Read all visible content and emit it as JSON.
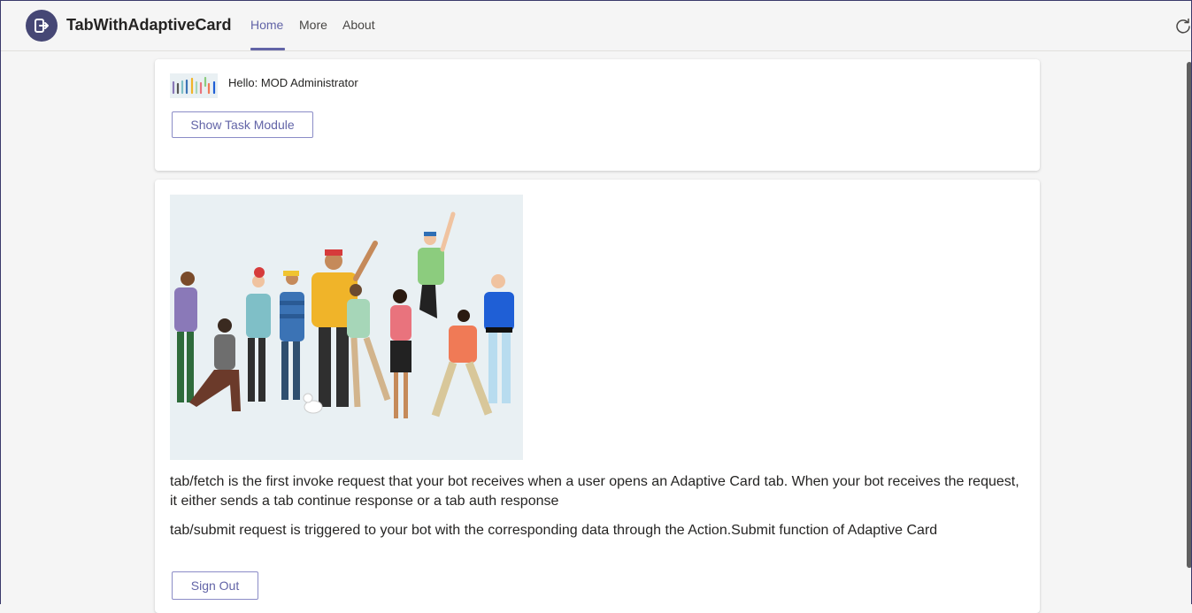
{
  "header": {
    "app_title": "TabWithAdaptiveCard",
    "tabs": [
      {
        "label": "Home",
        "active": true
      },
      {
        "label": "More",
        "active": false
      },
      {
        "label": "About",
        "active": false
      }
    ],
    "app_icon": "sign-out-arrow-icon",
    "refresh_icon": "refresh-icon"
  },
  "card1": {
    "greeting": "Hello: MOD Administrator",
    "button_label": "Show Task Module",
    "thumbnail": "people-group-thumbnail"
  },
  "card2": {
    "hero_image": "people-group-illustration",
    "paragraph1": "tab/fetch is the first invoke request that your bot receives when a user opens an Adaptive Card tab. When your bot receives the request, it either sends a tab continue response or a tab auth response",
    "paragraph2": "tab/submit request is triggered to your bot with the corresponding data through the Action.Submit function of Adaptive Card",
    "button_label": "Sign Out"
  },
  "colors": {
    "accent": "#6264a7",
    "app_icon_bg": "#464775",
    "background": "#f5f5f5",
    "card": "#ffffff",
    "hero_bg": "#e9f0f3"
  }
}
